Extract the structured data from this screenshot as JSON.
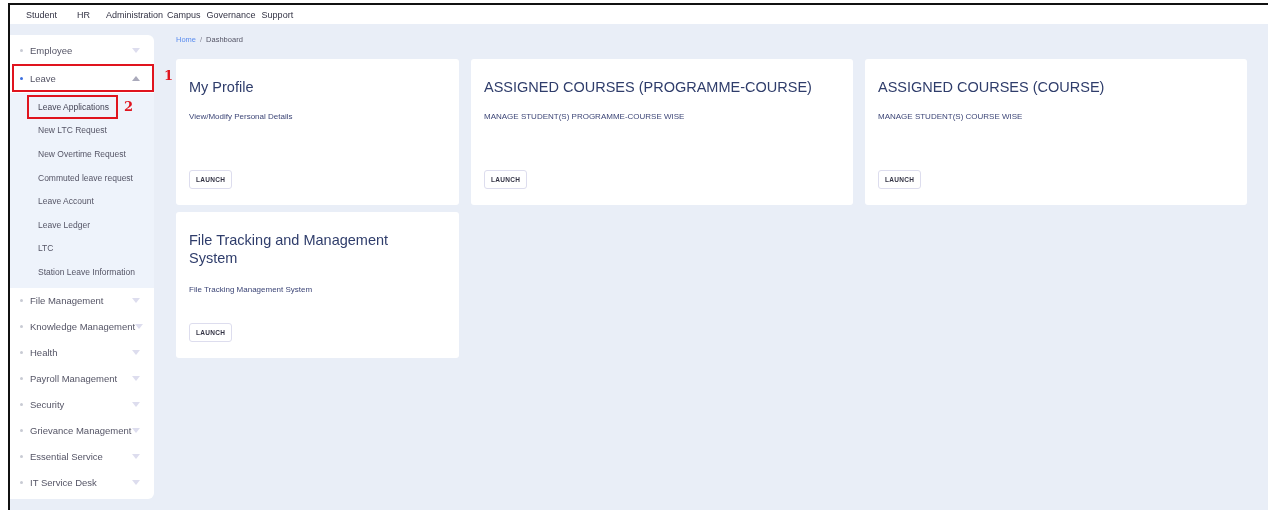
{
  "top_nav": [
    "Student",
    "HR",
    "Administration",
    "Campus",
    "Governance",
    "Support"
  ],
  "sidebar": {
    "items": [
      {
        "label": "Employee",
        "expanded": false,
        "selected": false
      },
      {
        "label": "Leave",
        "expanded": true,
        "selected": true,
        "callout": "1",
        "children": [
          {
            "label": "Leave Applications",
            "selected": true,
            "callout": "2"
          },
          {
            "label": "New LTC Request",
            "selected": false
          },
          {
            "label": "New Overtime Request",
            "selected": false
          },
          {
            "label": "Commuted leave request",
            "selected": false
          },
          {
            "label": "Leave Account",
            "selected": false
          },
          {
            "label": "Leave Ledger",
            "selected": false
          },
          {
            "label": "LTC",
            "selected": false
          },
          {
            "label": "Station Leave Information",
            "selected": false
          }
        ]
      },
      {
        "label": "File Management",
        "expanded": false,
        "selected": false
      },
      {
        "label": "Knowledge Management",
        "expanded": false,
        "selected": false
      },
      {
        "label": " Health",
        "expanded": false,
        "selected": false
      },
      {
        "label": "Payroll Management",
        "expanded": false,
        "selected": false
      },
      {
        "label": "Security",
        "expanded": false,
        "selected": false
      },
      {
        "label": "Grievance Management",
        "expanded": false,
        "selected": false
      },
      {
        "label": "Essential Service",
        "expanded": false,
        "selected": false
      },
      {
        "label": "IT Service Desk",
        "expanded": false,
        "selected": false
      }
    ]
  },
  "breadcrumb": [
    "Home",
    "Dashboard"
  ],
  "breadcrumb_separator": "/",
  "cards": [
    {
      "title": "My Profile",
      "description": "View/Modify Personal Details",
      "button": "LAUNCH"
    },
    {
      "title": "ASSIGNED COURSES (PROGRAMME-COURSE)",
      "description": "MANAGE STUDENT(S) PROGRAMME-COURSE WISE",
      "button": "LAUNCH"
    },
    {
      "title": "ASSIGNED COURSES (COURSE)",
      "description": "MANAGE STUDENT(S) COURSE WISE",
      "button": "LAUNCH"
    },
    {
      "title": "File Tracking and Management System",
      "description": "File Tracking Management System",
      "button": "LAUNCH"
    }
  ]
}
